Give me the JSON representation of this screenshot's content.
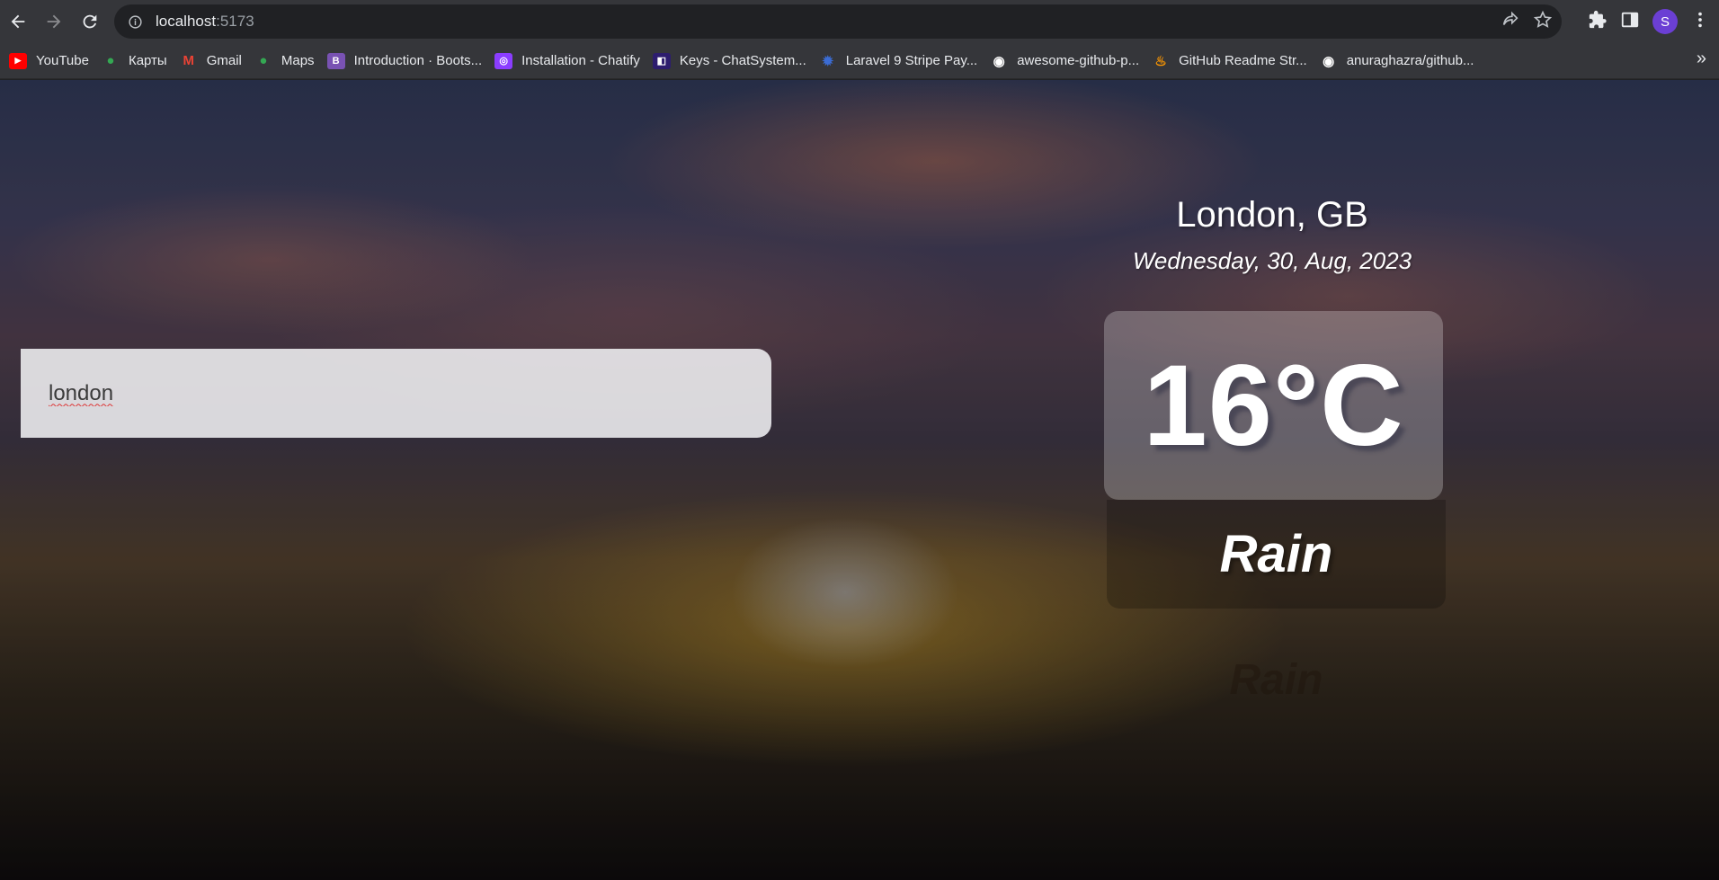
{
  "browser": {
    "url_host": "localhost",
    "url_port": ":5173",
    "profile_initial": "S"
  },
  "bookmarks": [
    {
      "label": "YouTube",
      "icon": "youtube-icon",
      "color": "#ff0000"
    },
    {
      "label": "Карты",
      "icon": "maps-pin-icon",
      "color": "#34a853"
    },
    {
      "label": "Gmail",
      "icon": "gmail-icon",
      "color": "#ea4335"
    },
    {
      "label": "Maps",
      "icon": "maps-pin-icon",
      "color": "#34a853"
    },
    {
      "label": "Introduction · Boots...",
      "icon": "bootstrap-icon",
      "color": "#7952b3"
    },
    {
      "label": "Installation - Chatify",
      "icon": "chatify-icon",
      "color": "#8b3dff"
    },
    {
      "label": "Keys - ChatSystem...",
      "icon": "keys-icon",
      "color": "#2d1d6e"
    },
    {
      "label": "Laravel 9 Stripe Pay...",
      "icon": "gear-icon",
      "color": "#3b6cd4"
    },
    {
      "label": "awesome-github-p...",
      "icon": "github-icon",
      "color": "#ffffff"
    },
    {
      "label": "GitHub Readme Str...",
      "icon": "fire-icon",
      "color": "#ff9800"
    },
    {
      "label": "anuraghazra/github...",
      "icon": "github-icon",
      "color": "#ffffff"
    }
  ],
  "search": {
    "value": "london"
  },
  "weather": {
    "location": "London, GB",
    "date": "Wednesday, 30, Aug, 2023",
    "temperature": "16°C",
    "condition": "Rain",
    "condition_ghost": "Rain"
  }
}
